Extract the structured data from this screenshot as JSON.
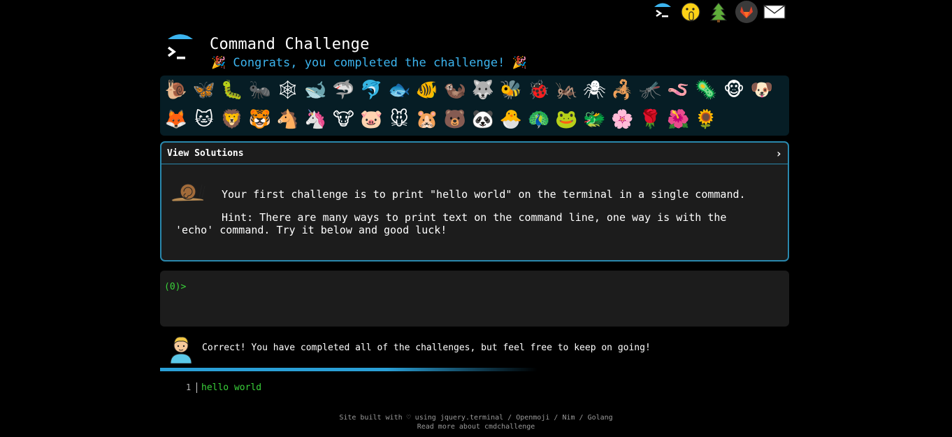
{
  "top_icons": [
    {
      "name": "cmdchallenge-logo-icon"
    },
    {
      "name": "hush-face-icon"
    },
    {
      "name": "evergreen-tree-icon"
    },
    {
      "name": "gitlab-icon"
    },
    {
      "name": "envelope-icon"
    }
  ],
  "header": {
    "title": "Command Challenge",
    "congrats": "🎉 Congrats, you completed the challenge! 🎉"
  },
  "emoji_rows": [
    [
      "🐌",
      "🦋",
      "🐛",
      "🐜",
      "🕸",
      "🐋",
      "🦈",
      "🐬",
      "🐟",
      "🐠",
      "🦦",
      "🐺",
      "🐝",
      "🐞",
      "🦗",
      "🕷",
      "🦂",
      "🦟",
      "🪱",
      "🦠",
      "🐵",
      "🐶"
    ],
    [
      "🦊",
      "🐱",
      "🦁",
      "🐯",
      "🐴",
      "🦄",
      "🐮",
      "🐷",
      "🐭",
      "🐹",
      "🐻",
      "🐼",
      "🐣",
      "🦚",
      "🐸",
      "🐲",
      "🌸",
      "🌹",
      "🌺",
      "🌻"
    ]
  ],
  "solutions": {
    "label": "View Solutions",
    "chevron": "›"
  },
  "challenge": {
    "icon": "snail-icon",
    "text": "Your first challenge is to print \"hello world\" on the terminal in a single command.",
    "hint": "Hint: There are many ways to print text on the command line, one way is with the 'echo' command. Try it below and good luck!"
  },
  "terminal": {
    "prompt": "(0)>"
  },
  "result": {
    "text": "Correct! You have completed all of the challenges, but feel free to keep on going!"
  },
  "output": {
    "line_number": "1",
    "line_text": "hello world"
  },
  "footer": {
    "prefix": "Site built with ♡ using",
    "links": [
      "jquery.terminal",
      "Openmoji",
      "Nim",
      "Golang"
    ],
    "separator": " / ",
    "read_more": "Read more about cmdchallenge"
  },
  "colors": {
    "accent": "#3cb4ee",
    "border": "#2a88ad",
    "terminal_green": "#3ad23a",
    "panel_bg": "#061d25"
  }
}
